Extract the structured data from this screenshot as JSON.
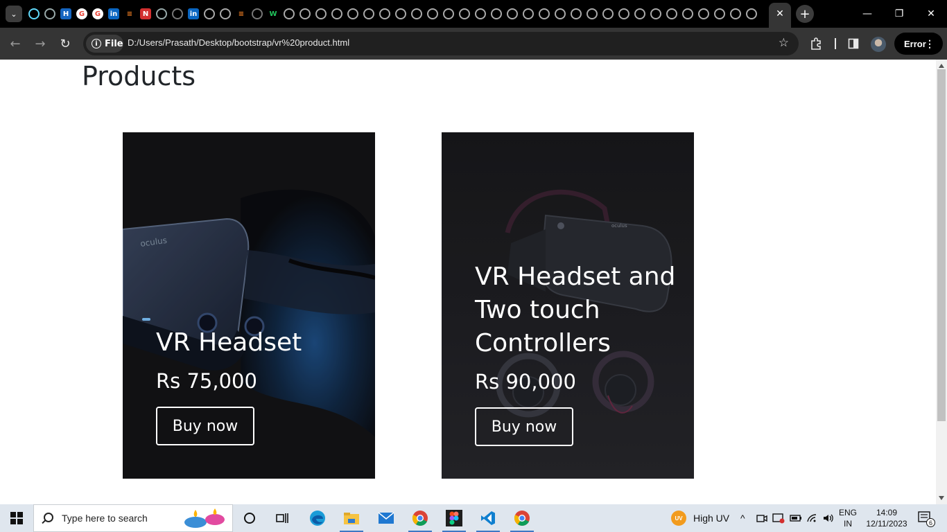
{
  "browser": {
    "tab_close_label": "✕",
    "window_controls": {
      "minimize": "—",
      "restore": "❐",
      "close": "✕"
    },
    "new_tab_label": "+",
    "site_chip_label": "File",
    "url": "D:/Users/Prasath/Desktop/bootstrap/vr%20product.html",
    "error_label": "Error"
  },
  "page": {
    "title": "Products",
    "cards": [
      {
        "title": "VR Headset",
        "price": "Rs 75,000",
        "button": "Buy now"
      },
      {
        "title": "VR Headset and Two touch Controllers",
        "price": "Rs 90,000",
        "button": "Buy now"
      }
    ]
  },
  "taskbar": {
    "search_placeholder": "Type here to search",
    "weather_label": "High UV",
    "weather_badge": "UV",
    "lang_line1": "ENG",
    "lang_line2": "IN",
    "time": "14:09",
    "date": "12/11/2023",
    "notification_count": "6"
  }
}
